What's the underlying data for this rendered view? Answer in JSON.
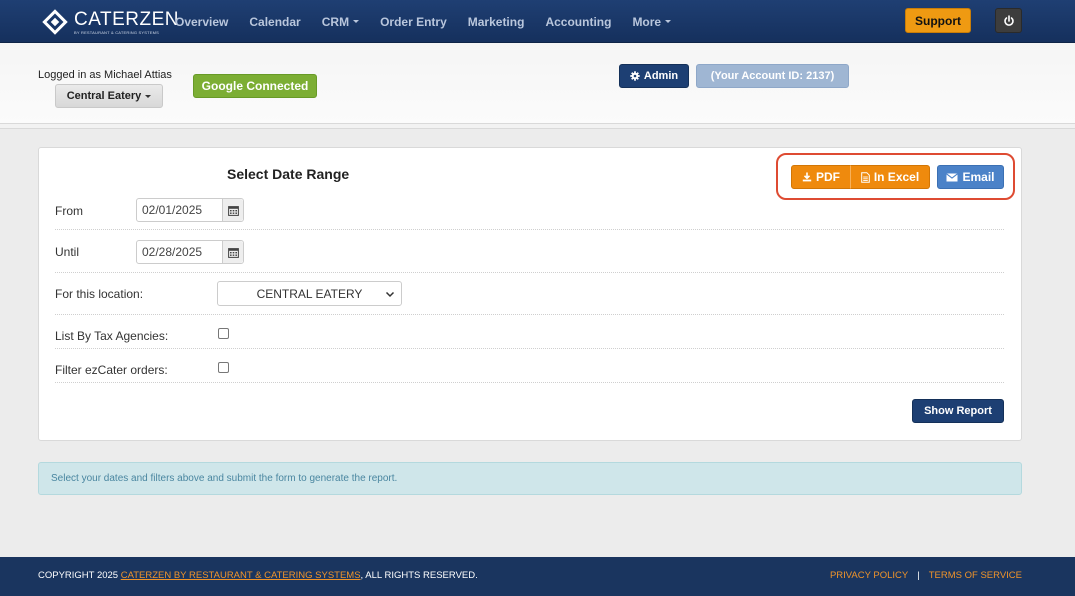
{
  "brand": {
    "name": "CATERZEN",
    "tagline": "by RESTAURANT & CATERING SYSTEMS"
  },
  "nav": {
    "items": [
      "Overview",
      "Calendar",
      "CRM",
      "Order Entry",
      "Marketing",
      "Accounting",
      "More"
    ],
    "dropdown_items": [
      "CRM",
      "More"
    ],
    "support_label": "Support"
  },
  "account": {
    "logged_in_text": "Logged in as Michael Attias",
    "location_label": "Central Eatery",
    "google_label": "Google Connected",
    "admin_label": "Admin",
    "account_id_label": "(Your Account ID: 2137)"
  },
  "report": {
    "title": "Select Date Range",
    "export": {
      "pdf_label": "PDF",
      "excel_label": "In Excel",
      "email_label": "Email"
    },
    "from_label": "From",
    "from_value": "02/01/2025",
    "until_label": "Until",
    "until_value": "02/28/2025",
    "location_label": "For this location:",
    "location_value": "CENTRAL EATERY",
    "tax_label": "List By Tax Agencies:",
    "tax_checked": false,
    "ezcater_label": "Filter ezCater orders:",
    "ezcater_checked": false,
    "submit_label": "Show Report"
  },
  "info_message": "Select your dates and filters above and submit the form to generate the report.",
  "footer": {
    "copyright_prefix": "COPYRIGHT 2025 ",
    "copyright_link": "CATERZEN BY RESTAURANT & CATERING SYSTEMS",
    "copyright_suffix": ", ALL RIGHTS RESERVED.",
    "privacy_label": "PRIVACY POLICY",
    "separator": "|",
    "terms_label": "TERMS OF SERVICE"
  },
  "colors": {
    "navbar": "#1f3f73",
    "support": "#ef9a12",
    "google": "#7cae34",
    "export_orange": "#ef8a0d",
    "email_blue": "#4b82c8",
    "highlight_outline": "#de4b32",
    "footer": "#1a355f"
  },
  "icons": {
    "logo": "caterzen-diamond-icon",
    "power": "power-icon",
    "admin": "gear-icon",
    "pdf": "download-icon",
    "excel": "file-icon",
    "email": "envelope-icon",
    "date": "calendar-icon",
    "select": "chevron-down-icon"
  }
}
